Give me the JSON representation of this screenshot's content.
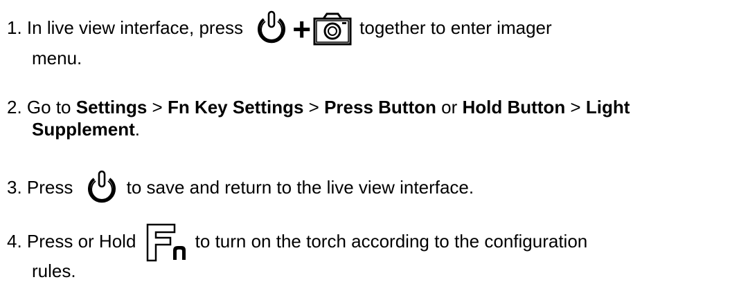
{
  "steps": [
    {
      "number": "1.",
      "pre": " In live view interface, press",
      "plus": "+",
      "post": "together to enter imager",
      "cont": "menu.",
      "icons": [
        "power-icon",
        "camera-icon"
      ]
    },
    {
      "number": "2.",
      "t1": " Go to ",
      "b1": "Settings",
      "t2": " > ",
      "b2": "Fn Key Settings",
      "t3": " > ",
      "b3": "Press Button",
      "t4": " or ",
      "b4": "Hold Button",
      "t5": " > ",
      "b5": "Light",
      "b6": "Supplement",
      "t6": "."
    },
    {
      "number": "3.",
      "pre": " Press",
      "post": "to save and return to the live view interface.",
      "icons": [
        "power-icon"
      ]
    },
    {
      "number": "4.",
      "pre": " Press or Hold",
      "post": "to turn on the torch according to the configuration",
      "cont": "rules.",
      "icons": [
        "fn-key-icon"
      ]
    }
  ]
}
